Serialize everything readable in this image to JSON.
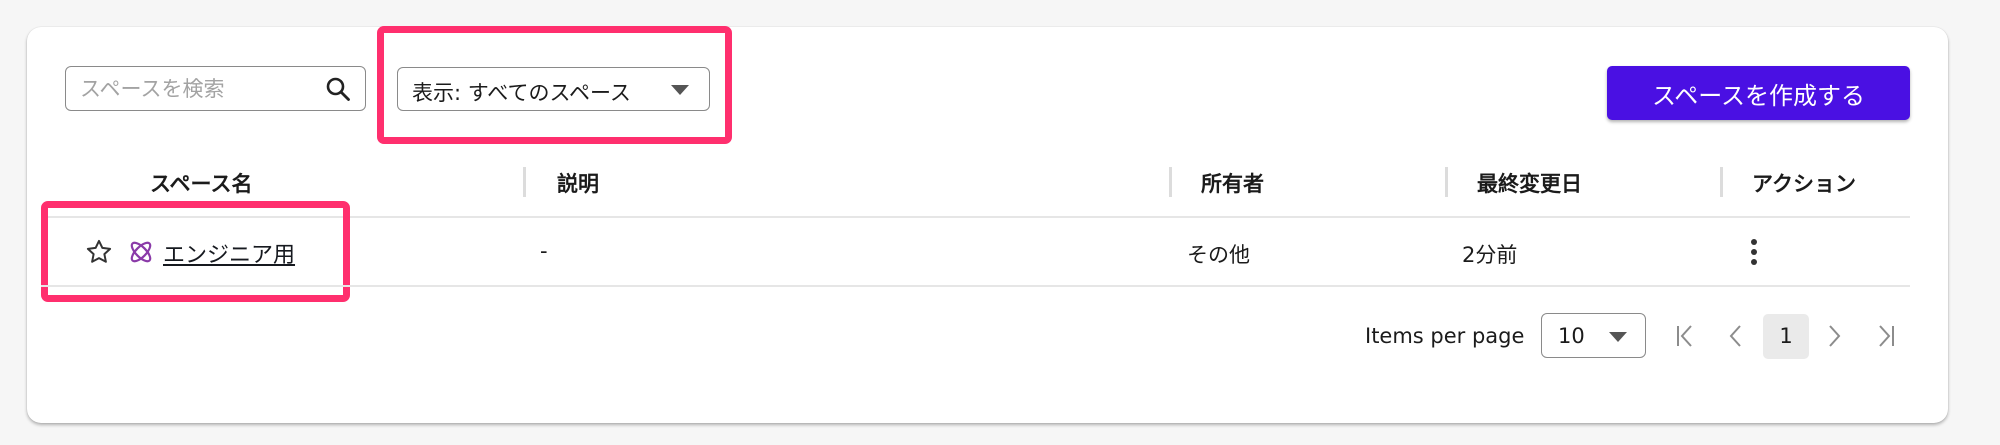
{
  "search": {
    "placeholder": "スペースを検索"
  },
  "filter": {
    "label": "表示: すべてのスペース"
  },
  "create_button": {
    "label": "スペースを作成する"
  },
  "table": {
    "headers": [
      "スペース名",
      "説明",
      "所有者",
      "最終変更日",
      "アクション"
    ],
    "rows": [
      {
        "name": "エンジニア用",
        "description": "-",
        "owner": "その他",
        "modified": "2分前"
      }
    ]
  },
  "pagination": {
    "items_per_page_label": "Items per page",
    "items_per_page_value": "10",
    "current_page": "1"
  },
  "colors": {
    "accent": "#4a10e3",
    "highlight": "#ff2f6e",
    "space_icon": "#8a3aa8"
  }
}
